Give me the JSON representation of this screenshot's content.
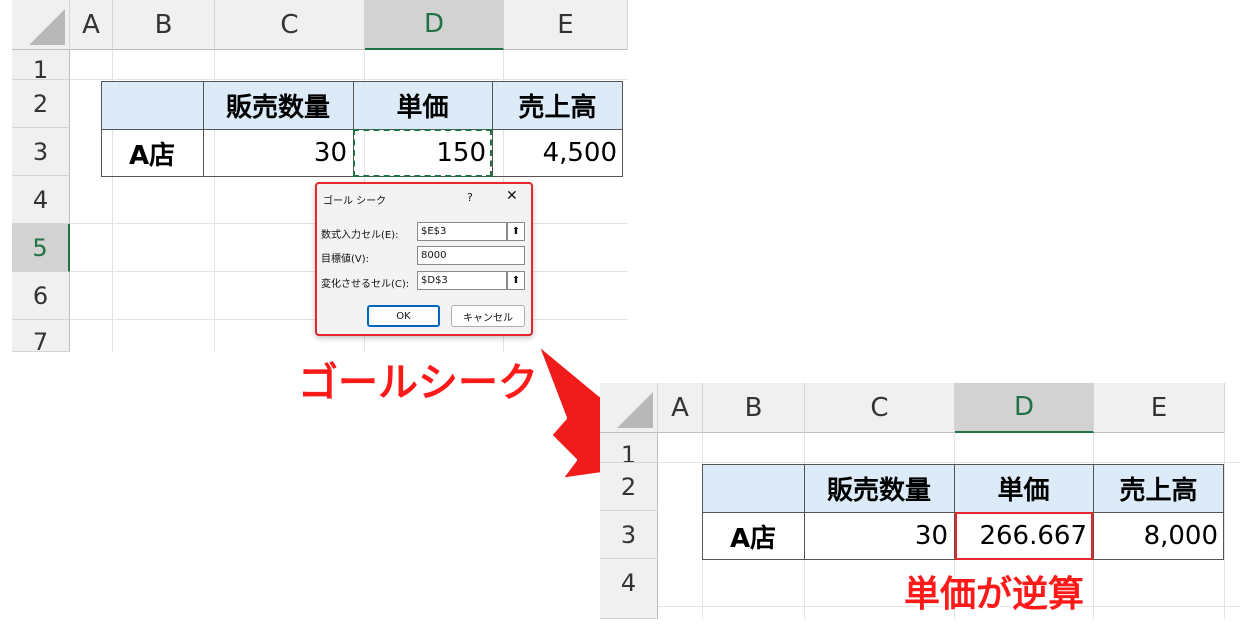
{
  "top_sheet": {
    "columns": [
      "A",
      "B",
      "C",
      "D",
      "E"
    ],
    "selected_column": "D",
    "rows": [
      "1",
      "2",
      "3",
      "4",
      "5",
      "6",
      "7"
    ],
    "selected_row": "5",
    "table": {
      "headers": [
        "",
        "販売数量",
        "単価",
        "売上高"
      ],
      "row_label": "A店",
      "values": [
        "30",
        "150",
        "4,500"
      ]
    }
  },
  "dialog": {
    "title": "ゴール シーク",
    "help_label": "?",
    "close_label": "✕",
    "fields": [
      {
        "label": "数式入力セル(E):",
        "value": "$E$3"
      },
      {
        "label": "目標値(V):",
        "value": "8000"
      },
      {
        "label": "変化させるセル(C):",
        "value": "$D$3"
      }
    ],
    "ok_label": "OK",
    "cancel_label": "キャンセル",
    "picker_icon": "collapse-dialog-icon"
  },
  "caption_goalseek": "ゴールシーク",
  "bottom_sheet": {
    "columns": [
      "A",
      "B",
      "C",
      "D",
      "E"
    ],
    "selected_column": "D",
    "rows": [
      "1",
      "2",
      "3",
      "4"
    ],
    "table": {
      "headers": [
        "",
        "販売数量",
        "単価",
        "売上高"
      ],
      "row_label": "A店",
      "values": [
        "30",
        "266.667",
        "8,000"
      ]
    }
  },
  "caption_result": "単価が逆算",
  "colors": {
    "accent_red": "#ff1a1a",
    "header_fill": "#dcebf7",
    "excel_green": "#217346"
  }
}
